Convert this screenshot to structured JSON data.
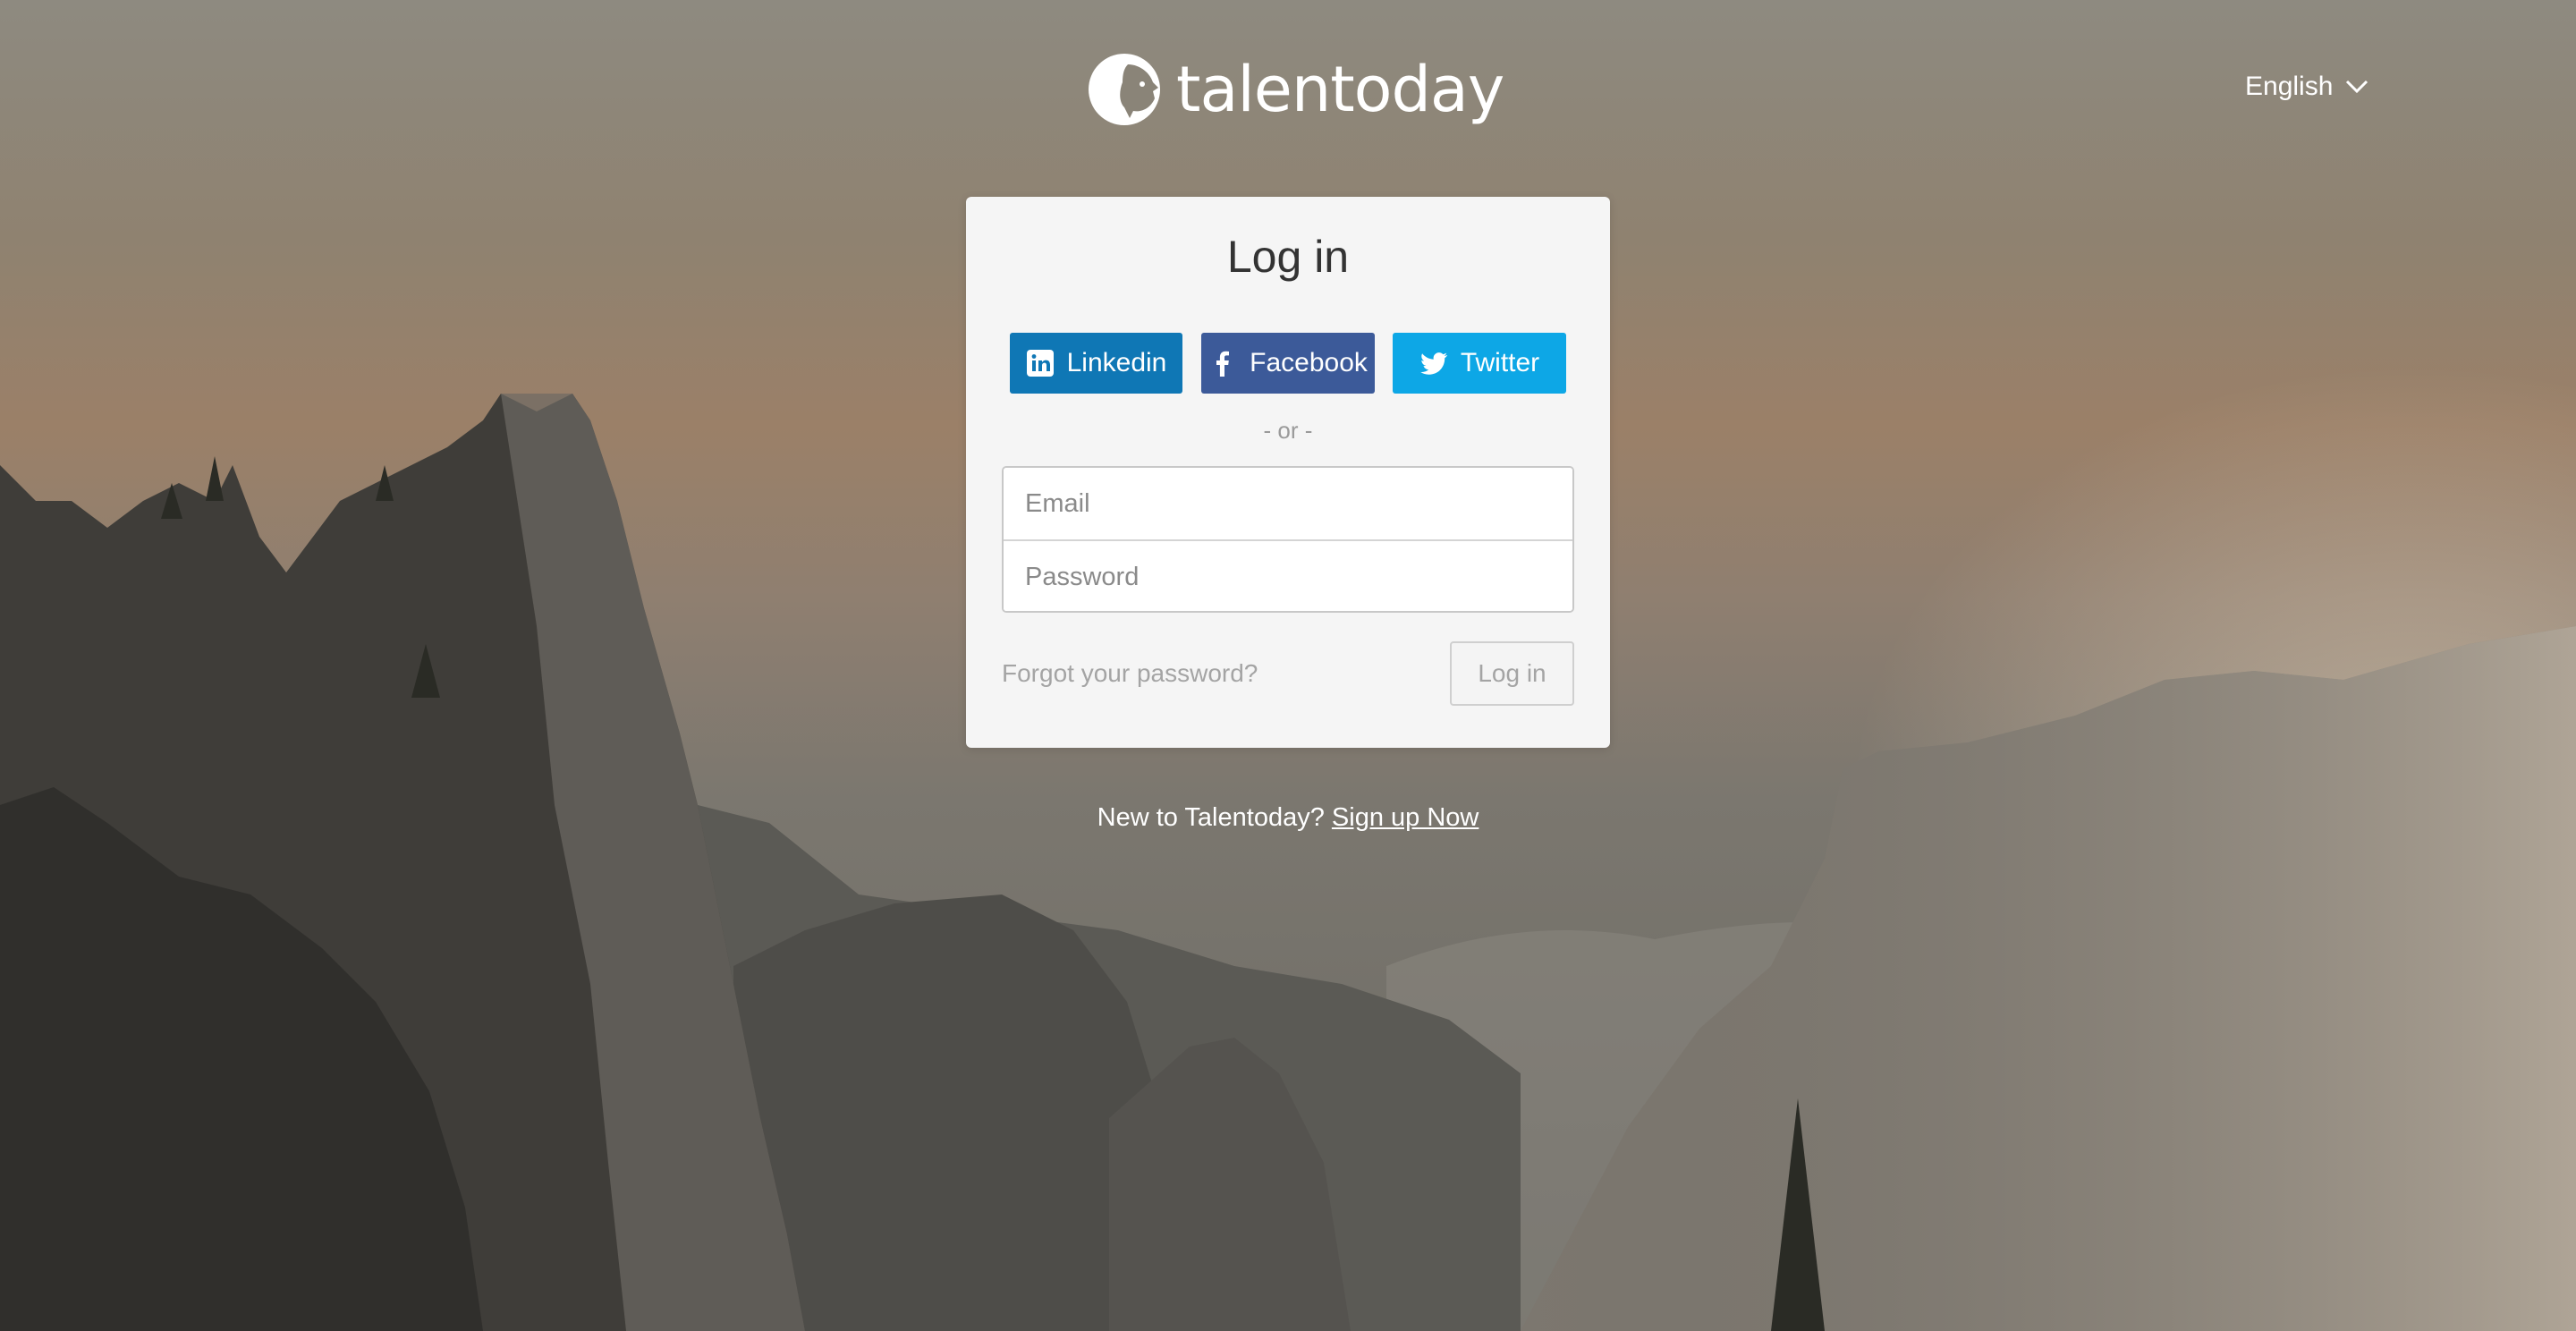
{
  "brand": {
    "name": "talentoday",
    "logo_icon": "lion-head-icon"
  },
  "language": {
    "selected": "English",
    "icon": "chevron-down-icon"
  },
  "login_card": {
    "title": "Log in",
    "social_buttons": [
      {
        "label": "Linkedin",
        "icon": "linkedin-icon",
        "color": "#0f77b5"
      },
      {
        "label": "Facebook",
        "icon": "facebook-icon",
        "color": "#3c5a99"
      },
      {
        "label": "Twitter",
        "icon": "twitter-icon",
        "color": "#0da7e6"
      }
    ],
    "or_separator": "- or -",
    "email_placeholder": "Email",
    "password_placeholder": "Password",
    "forgot_password": "Forgot your password?",
    "login_button": "Log in"
  },
  "signup": {
    "prompt": "New to Talentoday?",
    "link": "Sign up Now"
  }
}
